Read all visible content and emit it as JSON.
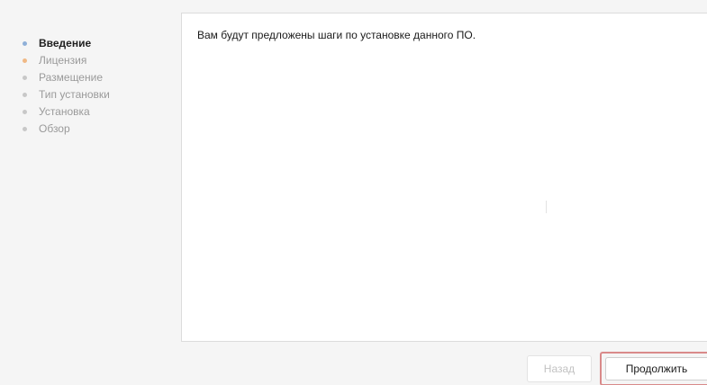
{
  "sidebar": {
    "steps": [
      {
        "label": "Введение",
        "state": "active"
      },
      {
        "label": "Лицензия",
        "state": "next"
      },
      {
        "label": "Размещение",
        "state": "pending"
      },
      {
        "label": "Тип установки",
        "state": "pending"
      },
      {
        "label": "Установка",
        "state": "pending"
      },
      {
        "label": "Обзор",
        "state": "pending"
      }
    ]
  },
  "main": {
    "intro_text": "Вам будут предложены шаги по установке данного ПО."
  },
  "footer": {
    "back_label": "Назад",
    "continue_label": "Продолжить"
  },
  "colors": {
    "active_dot": "#8fb0d8",
    "next_dot": "#f0b985",
    "pending_dot": "#c8c8c8",
    "continue_highlight": "#d98a8a"
  }
}
